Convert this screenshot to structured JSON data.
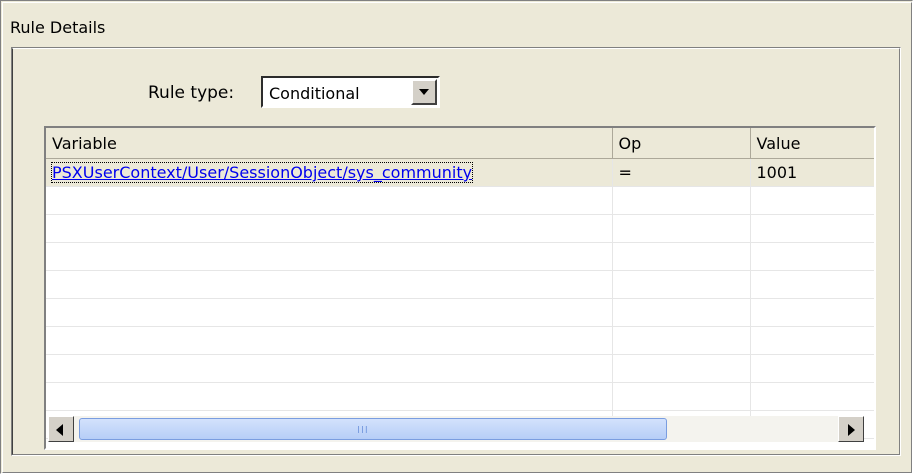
{
  "section": {
    "label": "Rule Details"
  },
  "rule_type": {
    "label": "Rule type:",
    "value": "Conditional"
  },
  "table": {
    "columns": [
      "Variable",
      "Op",
      "Value"
    ],
    "rows": [
      {
        "variable": "PSXUserContext/User/SessionObject/sys_community",
        "op": "=",
        "value": "1001"
      }
    ]
  },
  "scrollbar": {
    "grip": "III"
  },
  "colors": {
    "window": "#ece9d8",
    "selection": "#ece9d8",
    "link": "#0000ee"
  },
  "icons": {
    "dropdown": "chevron-down-icon",
    "scroll_left": "arrow-left-icon",
    "scroll_right": "arrow-right-icon"
  }
}
